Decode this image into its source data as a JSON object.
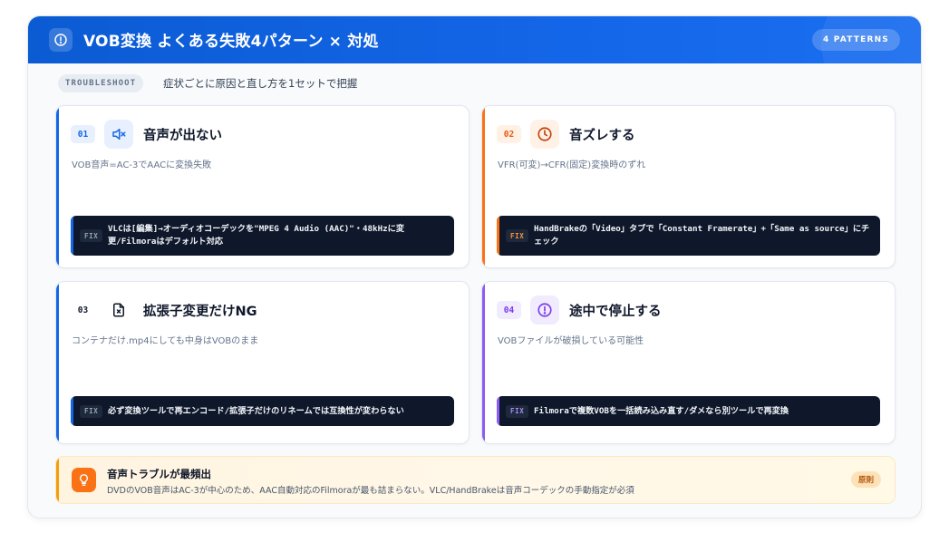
{
  "header": {
    "title": "VOB変換 よくある失敗4パターン × 対処",
    "badge": "4 PATTERNS",
    "icon": "alert-circle-icon"
  },
  "subheader": {
    "tag": "TROUBLESHOOT",
    "text": "症状ごとに原因と直し方を1セットで把握"
  },
  "cards": [
    {
      "num": "01",
      "title": "音声が出ない",
      "desc": "VOB音声=AC-3でAACに変換失敗",
      "fix_tag": "FIX",
      "fix": "VLCは[編集]→オーディオコーデックを\"MPEG 4 Audio (AAC)\"・48kHzに変更/Filmoraはデフォルト対応",
      "icon": "volume-mute-icon",
      "accent": "#1466e8"
    },
    {
      "num": "02",
      "title": "音ズレする",
      "desc": "VFR(可変)→CFR(固定)変換時のずれ",
      "fix_tag": "FIX",
      "fix": "HandBrakeの「Video」タブで「Constant Framerate」+「Same as source」にチェック",
      "icon": "clock-icon",
      "accent": "#f97316"
    },
    {
      "num": "03",
      "title": "拡張子変更だけNG",
      "desc": "コンテナだけ.mp4にしても中身はVOBのまま",
      "fix_tag": "FIX",
      "fix": "必ず変換ツールで再エンコード/拡張子だけのリネームでは互換性が変わらない",
      "icon": "file-x-icon",
      "accent": "#1466e8"
    },
    {
      "num": "04",
      "title": "途中で停止する",
      "desc": "VOBファイルが破損している可能性",
      "fix_tag": "FIX",
      "fix": "Filmoraで複数VOBを一括読み込み直す/ダメなら別ツールで再変換",
      "icon": "alert-circle-icon",
      "accent": "#8b5cf6"
    }
  ],
  "bottom": {
    "title": "音声トラブルが最頻出",
    "text": "DVDのVOB音声はAC-3が中心のため、AAC自動対応のFilmoraが最も詰まらない。VLC/HandBrakeは音声コーデックの手動指定が必須",
    "badge": "原則",
    "icon": "lightbulb-icon"
  }
}
